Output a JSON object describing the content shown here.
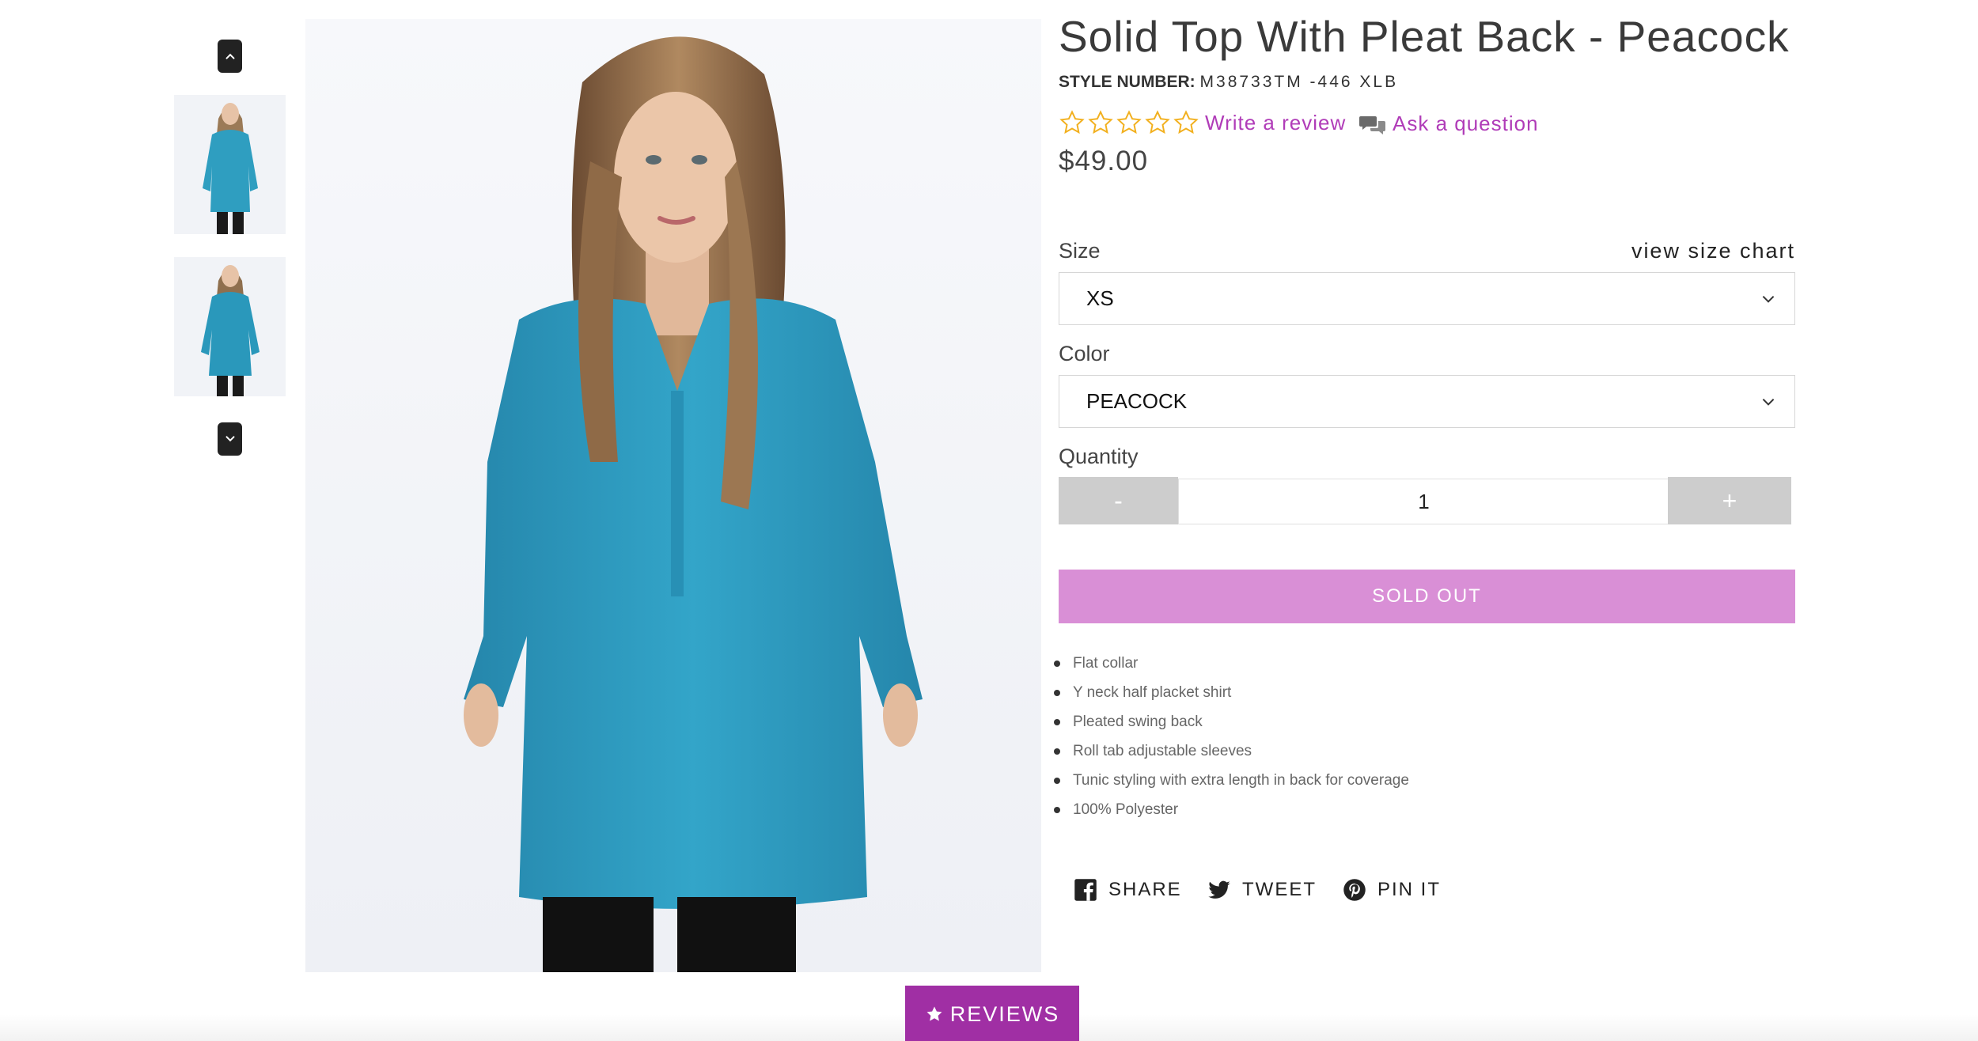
{
  "gallery": {
    "up_icon": "chevron-up-icon",
    "down_icon": "chevron-down-icon",
    "thumbnails": [
      "model-front-thumbnail",
      "model-front-alt-thumbnail"
    ]
  },
  "product": {
    "title": "Solid Top With Pleat Back - Peacock",
    "style_label": "STYLE NUMBER:",
    "style_value": "M38733TM -446 XLB",
    "rating": 0,
    "rating_max": 5,
    "write_review": "Write a review",
    "ask_question": "Ask a question",
    "price": "$49.00"
  },
  "options": {
    "size_label": "Size",
    "size_chart_link": "view size chart",
    "size_value": "XS",
    "color_label": "Color",
    "color_value": "PEACOCK",
    "quantity_label": "Quantity",
    "qty_minus": "-",
    "qty_value": "1",
    "qty_plus": "+"
  },
  "buy": {
    "sold_out_label": "SOLD OUT"
  },
  "features": [
    "Flat collar",
    "Y neck half placket shirt",
    "Pleated swing back",
    "Roll tab adjustable sleeves",
    "Tunic styling with extra length in back for coverage",
    "100% Polyester"
  ],
  "share": {
    "facebook": "SHARE",
    "twitter": "TWEET",
    "pinterest": "PIN IT"
  },
  "reviews_tab": "REVIEWS",
  "colors": {
    "accent": "#b03cb8",
    "sold_out_bg": "#d98fd6",
    "reviews_tab_bg": "#a02fa4",
    "star_outline": "#f2b01e",
    "shirt": "#2f9ec0"
  }
}
